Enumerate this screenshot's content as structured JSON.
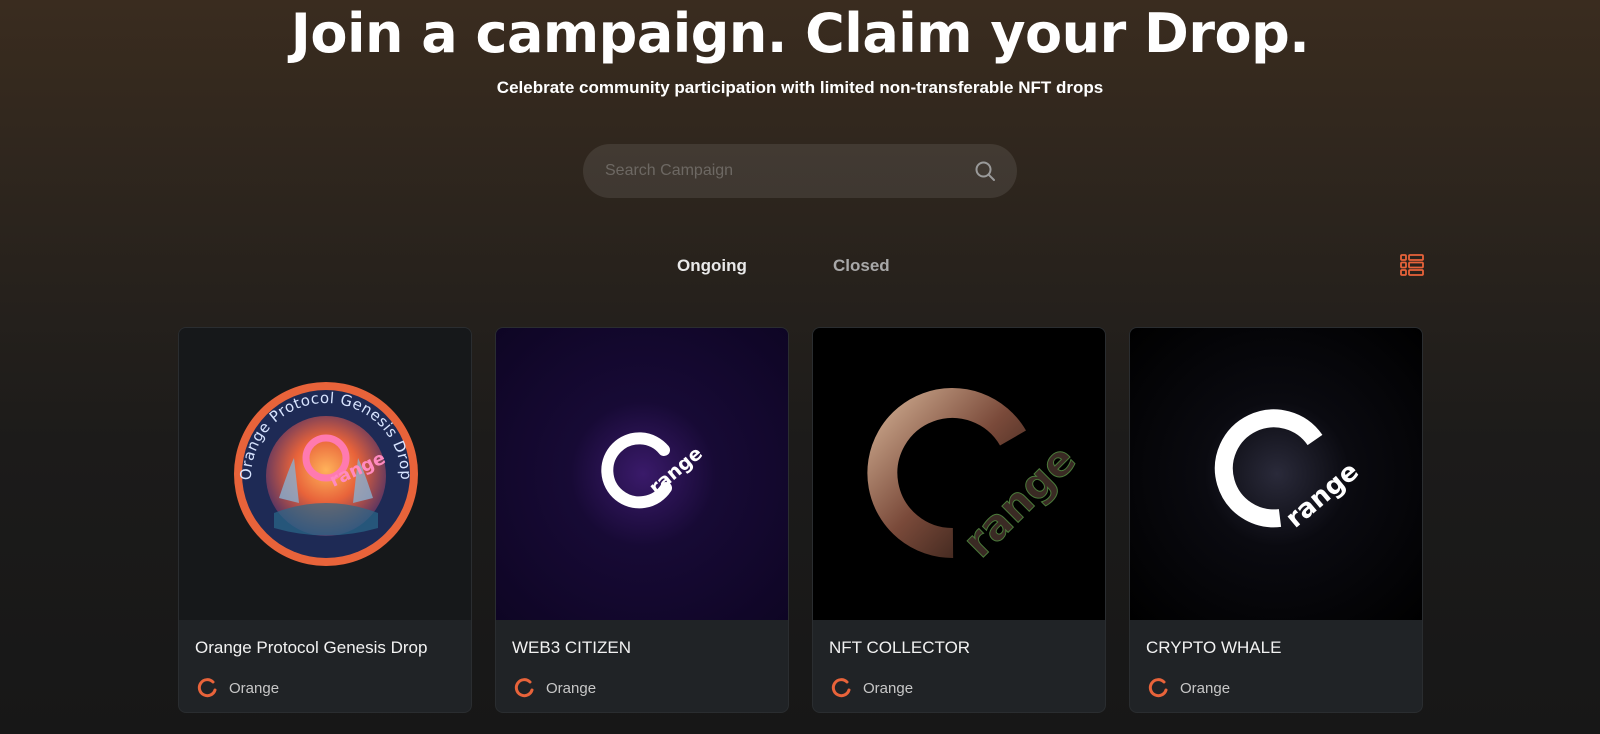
{
  "hero": {
    "title": "Join a campaign. Claim your Drop.",
    "subtitle": "Celebrate community participation with limited non-transferable NFT drops"
  },
  "search": {
    "placeholder": "Search Campaign",
    "value": "",
    "icon": "search-icon"
  },
  "tabs": [
    {
      "label": "Ongoing",
      "active": true
    },
    {
      "label": "Closed",
      "active": false
    }
  ],
  "view_toggle": {
    "icon": "list-view-icon",
    "color": "#e8633a"
  },
  "campaigns": [
    {
      "title": "Orange Protocol Genesis Drop",
      "brand": "Orange",
      "badge_text": "Orange Protocol Genesis Drop",
      "logo_text": "range"
    },
    {
      "title": "WEB3 CITIZEN",
      "brand": "Orange",
      "logo_text": "range"
    },
    {
      "title": "NFT COLLECTOR",
      "brand": "Orange",
      "logo_text": "range"
    },
    {
      "title": "CRYPTO WHALE",
      "brand": "Orange",
      "logo_text": "range"
    }
  ],
  "colors": {
    "accent": "#e8633a",
    "card_bg": "#202326"
  }
}
